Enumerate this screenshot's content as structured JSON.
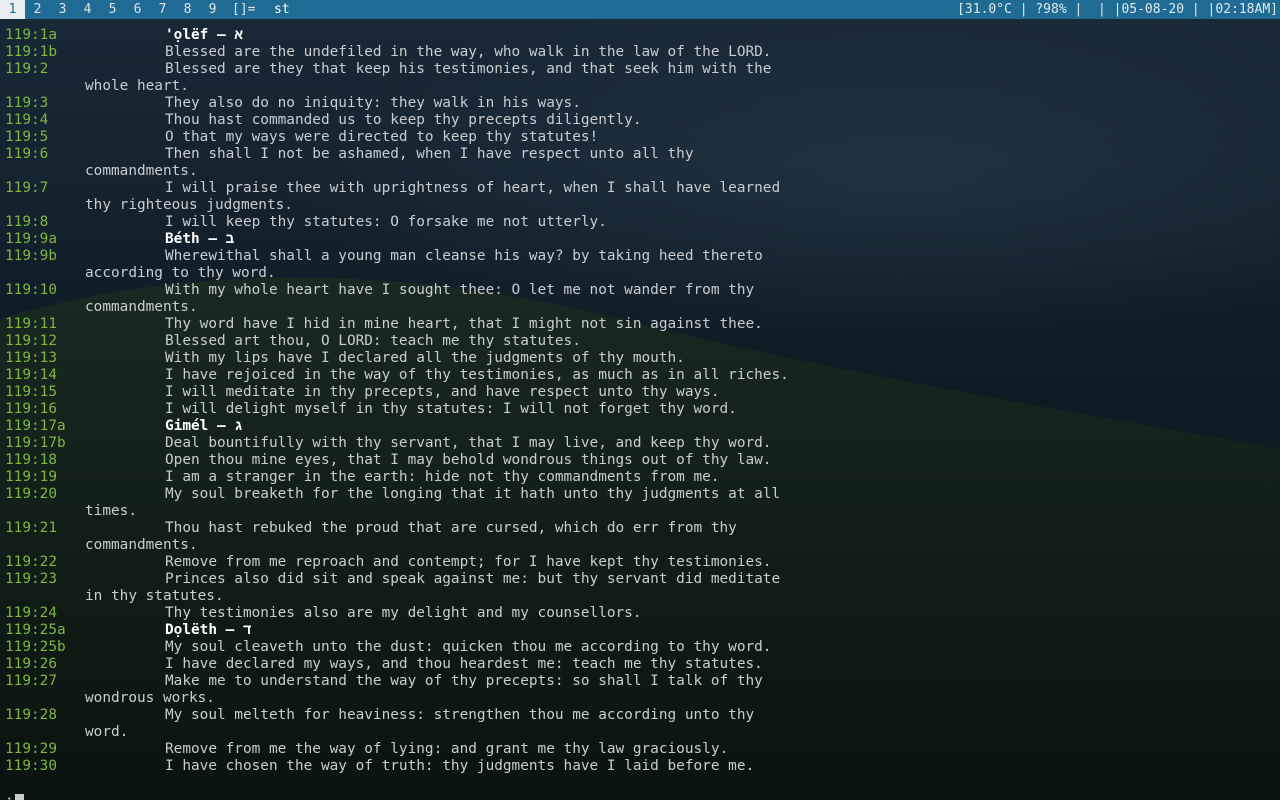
{
  "bar": {
    "tags": [
      {
        "label": "1",
        "selected": true,
        "occupied": true
      },
      {
        "label": "2",
        "selected": false,
        "occupied": true
      },
      {
        "label": "3",
        "selected": false,
        "occupied": true
      },
      {
        "label": "4",
        "selected": false,
        "occupied": false
      },
      {
        "label": "5",
        "selected": false,
        "occupied": false
      },
      {
        "label": "6",
        "selected": false,
        "occupied": false
      },
      {
        "label": "7",
        "selected": false,
        "occupied": false
      },
      {
        "label": "8",
        "selected": false,
        "occupied": true
      },
      {
        "label": "9",
        "selected": false,
        "occupied": true
      }
    ],
    "layout_symbol": "[]=",
    "window_title": "st",
    "status": "[31.0°C | ?98% |  | |05-08-20 | |02:18AM]",
    "colors": {
      "bar_bg": "#1f6b93",
      "selected_tag_bg": "#e8eef2"
    }
  },
  "terminal": {
    "colors": {
      "reference": "#7fb742",
      "text": "#c9cdd0",
      "header": "#ffffff"
    },
    "lines": [
      {
        "ref": "119:1a",
        "text": "'ọlëf – א",
        "header": true
      },
      {
        "ref": "119:1b",
        "text": "Blessed are the undefiled in the way, who walk in the law of the LORD."
      },
      {
        "ref": "119:2",
        "text": "Blessed are they that keep his testimonies, and that seek him with the"
      },
      {
        "ref": "",
        "text": "whole heart.",
        "cont": true
      },
      {
        "ref": "119:3",
        "text": "They also do no iniquity: they walk in his ways."
      },
      {
        "ref": "119:4",
        "text": "Thou hast commanded us to keep thy precepts diligently."
      },
      {
        "ref": "119:5",
        "text": "O that my ways were directed to keep thy statutes!"
      },
      {
        "ref": "119:6",
        "text": "Then shall I not be ashamed, when I have respect unto all thy"
      },
      {
        "ref": "",
        "text": "commandments.",
        "cont": true
      },
      {
        "ref": "119:7",
        "text": "I will praise thee with uprightness of heart, when I shall have learned"
      },
      {
        "ref": "",
        "text": "thy righteous judgments.",
        "cont": true,
        "flush": true
      },
      {
        "ref": "119:8",
        "text": "I will keep thy statutes: O forsake me not utterly."
      },
      {
        "ref": "119:9a",
        "text": "Béth – ב",
        "header": true
      },
      {
        "ref": "119:9b",
        "text": "Wherewithal shall a young man cleanse his way? by taking heed thereto"
      },
      {
        "ref": "",
        "text": "according to thy word.",
        "cont": true
      },
      {
        "ref": "119:10",
        "text": "With my whole heart have I sought thee: O let me not wander from thy"
      },
      {
        "ref": "",
        "text": "commandments.",
        "cont": true
      },
      {
        "ref": "119:11",
        "text": "Thy word have I hid in mine heart, that I might not sin against thee."
      },
      {
        "ref": "119:12",
        "text": "Blessed art thou, O LORD: teach me thy statutes."
      },
      {
        "ref": "119:13",
        "text": "With my lips have I declared all the judgments of thy mouth."
      },
      {
        "ref": "119:14",
        "text": "I have rejoiced in the way of thy testimonies, as much as in all riches."
      },
      {
        "ref": "119:15",
        "text": "I will meditate in thy precepts, and have respect unto thy ways."
      },
      {
        "ref": "119:16",
        "text": "I will delight myself in thy statutes: I will not forget thy word."
      },
      {
        "ref": "119:17a",
        "text": "Gimél – ג",
        "header": true
      },
      {
        "ref": "119:17b",
        "text": "Deal bountifully with thy servant, that I may live, and keep thy word."
      },
      {
        "ref": "119:18",
        "text": "Open thou mine eyes, that I may behold wondrous things out of thy law."
      },
      {
        "ref": "119:19",
        "text": "I am a stranger in the earth: hide not thy commandments from me."
      },
      {
        "ref": "119:20",
        "text": "My soul breaketh for the longing that it hath unto thy judgments at all"
      },
      {
        "ref": "",
        "text": "times.",
        "cont": true
      },
      {
        "ref": "119:21",
        "text": "Thou hast rebuked the proud that are cursed, which do err from thy"
      },
      {
        "ref": "",
        "text": "commandments.",
        "cont": true
      },
      {
        "ref": "119:22",
        "text": "Remove from me reproach and contempt; for I have kept thy testimonies."
      },
      {
        "ref": "119:23",
        "text": "Princes also did sit and speak against me: but thy servant did meditate"
      },
      {
        "ref": "",
        "text": "in thy statutes.",
        "cont": true
      },
      {
        "ref": "119:24",
        "text": "Thy testimonies also are my delight and my counsellors."
      },
      {
        "ref": "119:25a",
        "text": "Dọlëth – ד",
        "header": true
      },
      {
        "ref": "119:25b",
        "text": "My soul cleaveth unto the dust: quicken thou me according to thy word."
      },
      {
        "ref": "119:26",
        "text": "I have declared my ways, and thou heardest me: teach me thy statutes."
      },
      {
        "ref": "119:27",
        "text": "Make me to understand the way of thy precepts: so shall I talk of thy"
      },
      {
        "ref": "",
        "text": "wondrous works.",
        "cont": true
      },
      {
        "ref": "119:28",
        "text": "My soul melteth for heaviness: strengthen thou me according unto thy"
      },
      {
        "ref": "",
        "text": "word.",
        "cont": true
      },
      {
        "ref": "119:29",
        "text": "Remove from me the way of lying: and grant me thy law graciously."
      },
      {
        "ref": "119:30",
        "text": "I have chosen the way of truth: thy judgments have I laid before me."
      }
    ],
    "prompt": ":"
  }
}
